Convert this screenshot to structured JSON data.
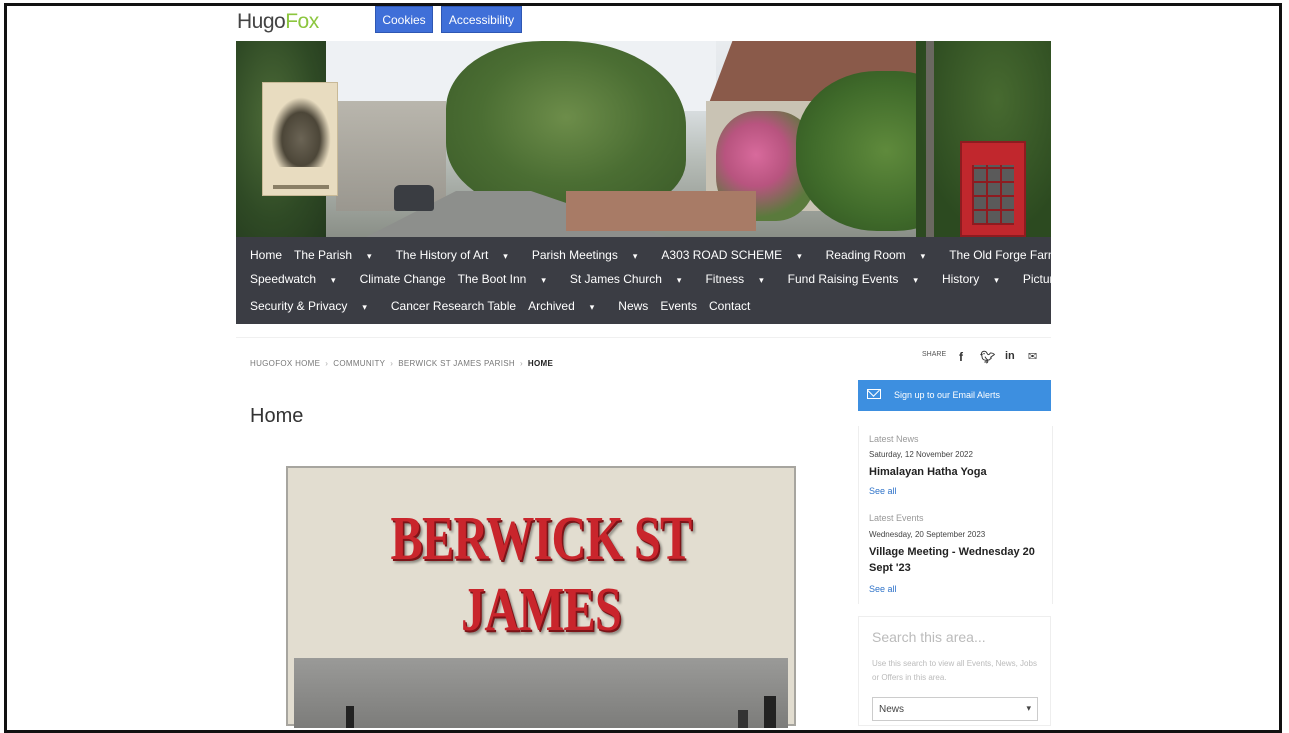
{
  "header": {
    "logo_part1": "Hugo",
    "logo_part2": "Fox",
    "cookies_label": "Cookies",
    "accessibility_label": "Accessibility"
  },
  "nav": {
    "row1": [
      "Home",
      "The Parish",
      "The History of Art",
      "Parish Meetings",
      "A303 ROAD SCHEME",
      "Reading Room",
      "The Old Forge Farm Shop"
    ],
    "row2": [
      "Speedwatch",
      "Climate Change",
      "The Boot Inn",
      "St James Church",
      "Fitness",
      "Fund Raising Events",
      "History",
      "Picture Gallery"
    ],
    "row3": [
      "Security & Privacy",
      "Cancer Research Table",
      "Archived",
      "News",
      "Events",
      "Contact"
    ]
  },
  "breadcrumb": {
    "items": [
      "HUGOFOX HOME",
      "COMMUNITY",
      "BERWICK ST JAMES PARISH",
      "HOME"
    ],
    "separator": "›",
    "share_label": "SHARE"
  },
  "main": {
    "page_title": "Home",
    "poster_title": "BERWICK ST JAMES"
  },
  "sidebar": {
    "email_label": "Sign up to our Email Alerts",
    "latest_news_label": "Latest News",
    "news_date": "Saturday, 12 November 2022",
    "news_headline": "Himalayan Hatha Yoga",
    "news_see_all": "See all",
    "latest_events_label": "Latest Events",
    "event_date": "Wednesday, 20 September 2023",
    "event_headline": "Village Meeting - Wednesday 20 Sept '23",
    "event_see_all": "See all",
    "search_title": "Search this area...",
    "search_help": "Use this search to view all Events, News, Jobs or Offers in this area.",
    "search_select_value": "News"
  },
  "colors": {
    "nav_bg": "#3b3d44",
    "brand_green": "#8cc63f",
    "top_button_blue": "#3f6fd8",
    "email_button_blue": "#3d8fe0",
    "poster_red": "#c9252c"
  }
}
